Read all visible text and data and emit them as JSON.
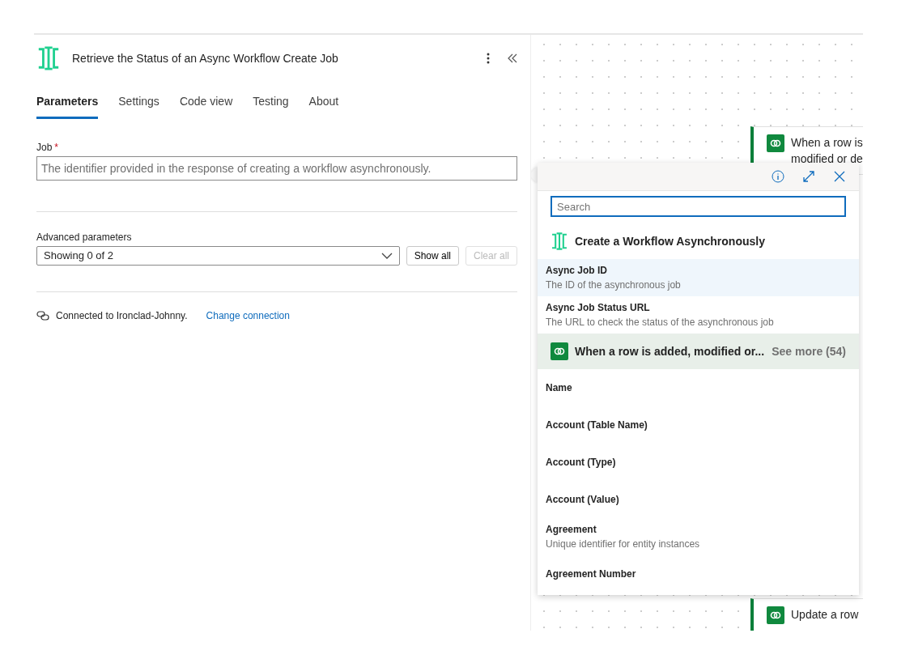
{
  "panel": {
    "title": "Retrieve the Status of an Async Workflow Create Job",
    "tabs": [
      {
        "label": "Parameters",
        "selected": true
      },
      {
        "label": "Settings",
        "selected": false
      },
      {
        "label": "Code view",
        "selected": false
      },
      {
        "label": "Testing",
        "selected": false
      },
      {
        "label": "About",
        "selected": false
      }
    ],
    "job_field": {
      "label": "Job",
      "required": true,
      "required_mark": "*",
      "placeholder": "The identifier provided in the response of creating a workflow asynchronously."
    },
    "advanced": {
      "label": "Advanced parameters",
      "value": "Showing 0 of 2",
      "buttons": [
        {
          "label": "Show all",
          "disabled": false
        },
        {
          "label": "Clear all",
          "disabled": true
        }
      ]
    },
    "connection": {
      "text": "Connected to Ironclad-Johnny.",
      "link": "Change connection"
    }
  },
  "canvas": {
    "cards": [
      {
        "lines": [
          "When a row is",
          "modified or de"
        ],
        "kind": "node"
      },
      {
        "lines": [
          "Update a row"
        ],
        "kind": "node"
      }
    ]
  },
  "popup": {
    "search": {
      "placeholder": "Search"
    },
    "groups": [
      {
        "title": "Create a Workflow Asynchronously",
        "kind": "ironclad",
        "items": [
          {
            "name": "Async Job ID",
            "description": "The ID of the asynchronous job",
            "selected": true
          },
          {
            "name": "Async Job Status URL",
            "description": "The URL to check the status of the asynchronous job",
            "selected": false
          }
        ]
      },
      {
        "title": "When a row is added, modified or...",
        "kind": "dataverse",
        "see_more": "See more (54)",
        "items": [
          {
            "name": "Name",
            "selected": false
          },
          {
            "name": "Account (Table Name)",
            "selected": false
          },
          {
            "name": "Account (Type)",
            "selected": false
          },
          {
            "name": "Account (Value)",
            "selected": false
          },
          {
            "name": "Agreement",
            "description": "Unique identifier for entity instances",
            "selected": false
          },
          {
            "name": "Agreement Number",
            "selected": false
          }
        ]
      }
    ]
  }
}
